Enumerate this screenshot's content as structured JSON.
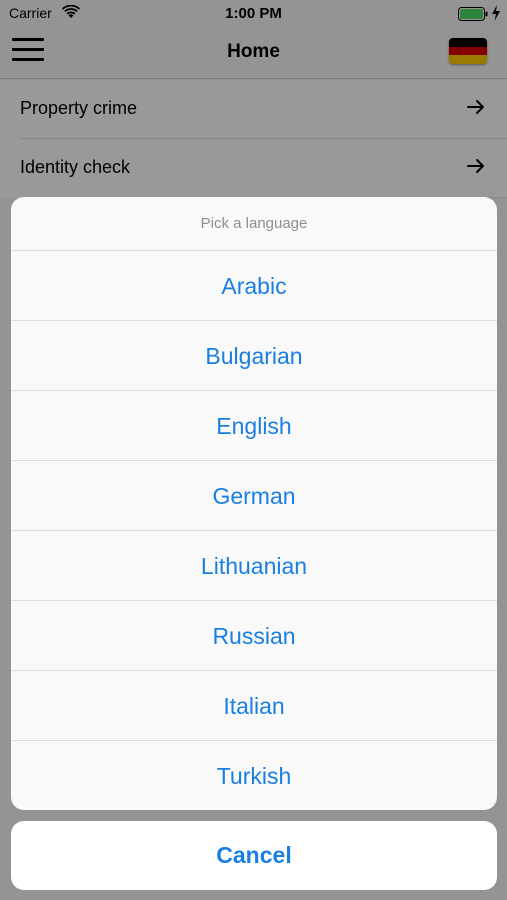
{
  "status_bar": {
    "carrier": "Carrier",
    "time": "1:00 PM",
    "battery_color": "#4cd964",
    "icons": [
      "wifi-icon",
      "battery-icon",
      "charging-icon"
    ]
  },
  "nav": {
    "title": "Home",
    "menu_icon": "hamburger-menu-icon",
    "flag_icon": "germany-flag-icon",
    "flag_colors": [
      "#000000",
      "#dd0000",
      "#ffce00"
    ]
  },
  "list": {
    "items": [
      {
        "label": "Property crime",
        "icon": "arrow-right-icon"
      },
      {
        "label": "Identity check",
        "icon": "arrow-right-icon"
      }
    ]
  },
  "language_sheet": {
    "title": "Pick a language",
    "options": [
      "Arabic",
      "Bulgarian",
      "English",
      "German",
      "Lithuanian",
      "Russian",
      "Italian",
      "Turkish"
    ],
    "cancel_label": "Cancel",
    "accent_color": "#1a7fe0"
  }
}
